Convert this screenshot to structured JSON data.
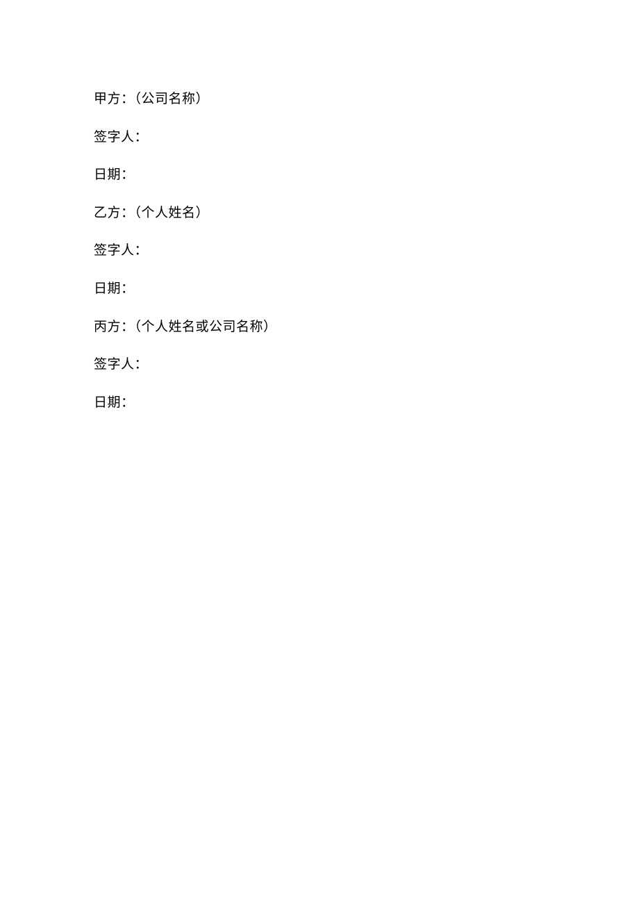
{
  "document": {
    "lines": [
      "甲方：（公司名称）",
      "签字人：",
      "日期：",
      "乙方：（个人姓名）",
      "签字人：",
      "日期：",
      "丙方：（个人姓名或公司名称）",
      "签字人：",
      "日期："
    ]
  }
}
